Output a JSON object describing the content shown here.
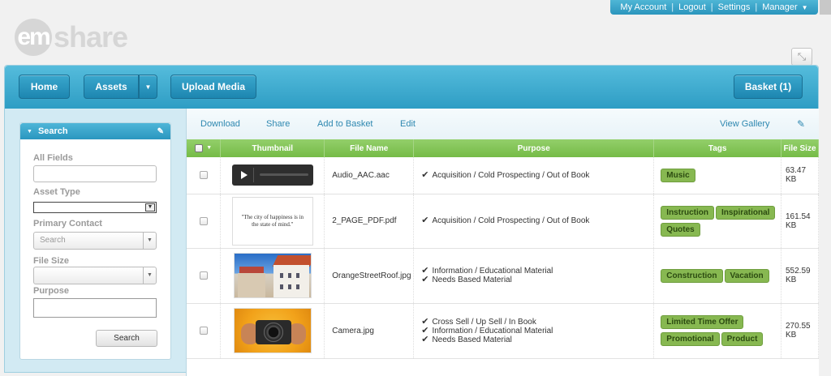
{
  "account_bar": {
    "links": [
      "My Account",
      "Logout",
      "Settings",
      "Manager"
    ]
  },
  "logo": {
    "part1": "em",
    "part2": "share"
  },
  "nav": {
    "home": "Home",
    "assets": "Assets",
    "upload": "Upload Media",
    "basket": "Basket (1)"
  },
  "search_panel": {
    "title": "Search",
    "all_fields_label": "All Fields",
    "asset_type_label": "Asset Type",
    "primary_contact_label": "Primary Contact",
    "primary_contact_placeholder": "Search",
    "file_size_label": "File Size",
    "purpose_label": "Purpose",
    "search_button": "Search"
  },
  "toolbar": {
    "download": "Download",
    "share": "Share",
    "add_to_basket": "Add to Basket",
    "edit": "Edit",
    "view_gallery": "View Gallery"
  },
  "table": {
    "headers": {
      "thumbnail": "Thumbnail",
      "file_name": "File Name",
      "purpose": "Purpose",
      "tags": "Tags",
      "file_size": "File Size"
    },
    "rows": [
      {
        "file_name": "Audio_AAC.aac",
        "thumb_type": "audio",
        "purposes": [
          "Acquisition / Cold Prospecting / Out of Book"
        ],
        "tags": [
          "Music"
        ],
        "size_value": "63.47",
        "size_unit": "KB"
      },
      {
        "file_name": "2_PAGE_PDF.pdf",
        "thumb_type": "pdf",
        "thumb_text": "\"The city of happiness is in the state of mind.\"",
        "purposes": [
          "Acquisition / Cold Prospecting / Out of Book"
        ],
        "tags": [
          "Instruction",
          "Inspirational",
          "Quotes"
        ],
        "size_value": "161.54",
        "size_unit": "KB"
      },
      {
        "file_name": "OrangeStreetRoof.jpg",
        "thumb_type": "street-photo",
        "purposes": [
          "Information / Educational Material",
          "Needs Based Material"
        ],
        "tags": [
          "Construction",
          "Vacation"
        ],
        "size_value": "552.59",
        "size_unit": "KB"
      },
      {
        "file_name": "Camera.jpg",
        "thumb_type": "camera-photo",
        "purposes": [
          "Cross Sell / Up Sell / In Book",
          "Information / Educational Material",
          "Needs Based Material"
        ],
        "tags": [
          "Limited Time Offer",
          "Promotional",
          "Product"
        ],
        "size_value": "270.55",
        "size_unit": "KB"
      }
    ]
  },
  "colors": {
    "nav_blue": "#2e9dc4",
    "header_green": "#75bb47",
    "tag_green": "#87b851",
    "link_blue": "#2e88b0"
  }
}
